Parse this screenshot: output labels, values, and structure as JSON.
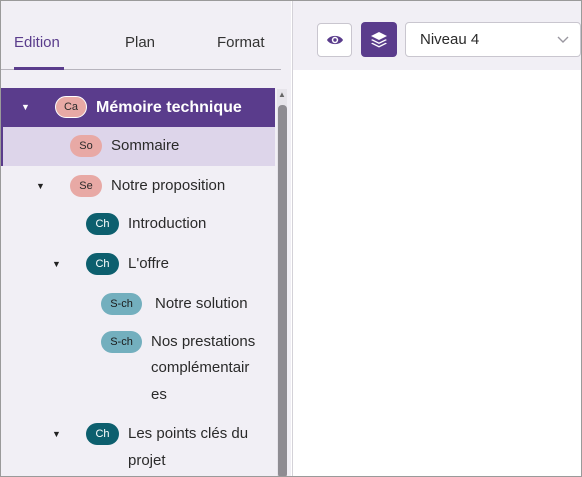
{
  "tabs": [
    {
      "label": "Edition",
      "active": true
    },
    {
      "label": "Plan",
      "active": false
    },
    {
      "label": "Format",
      "active": false
    }
  ],
  "tree": {
    "root": {
      "badge": "Ca",
      "label": "Mémoire technique"
    },
    "sommaire": {
      "badge": "So",
      "label": "Sommaire"
    },
    "proposition": {
      "badge": "Se",
      "label": "Notre proposition"
    },
    "introduction": {
      "badge": "Ch",
      "label": "Introduction"
    },
    "offre": {
      "badge": "Ch",
      "label": "L'offre"
    },
    "solution": {
      "badge": "S-ch",
      "label": "Notre solution"
    },
    "prestations": {
      "badge": "S-ch",
      "label_lines": [
        "Nos prestations",
        "complémentair",
        "es"
      ]
    },
    "points": {
      "badge": "Ch",
      "label_lines": [
        "Les points clés du",
        "projet"
      ]
    }
  },
  "toolbar": {
    "preview_icon": "eye-icon",
    "layers_icon": "layers-icon",
    "level_select": {
      "value": "Niveau 4"
    }
  },
  "colors": {
    "accent": "#5a3c8c",
    "selected_bg": "#ddd5ea",
    "panel_bg": "#f1eff5",
    "badge_pink": "#e8a9a5",
    "badge_teal_dark": "#0d5f6e",
    "badge_teal_light": "#73afbe"
  }
}
